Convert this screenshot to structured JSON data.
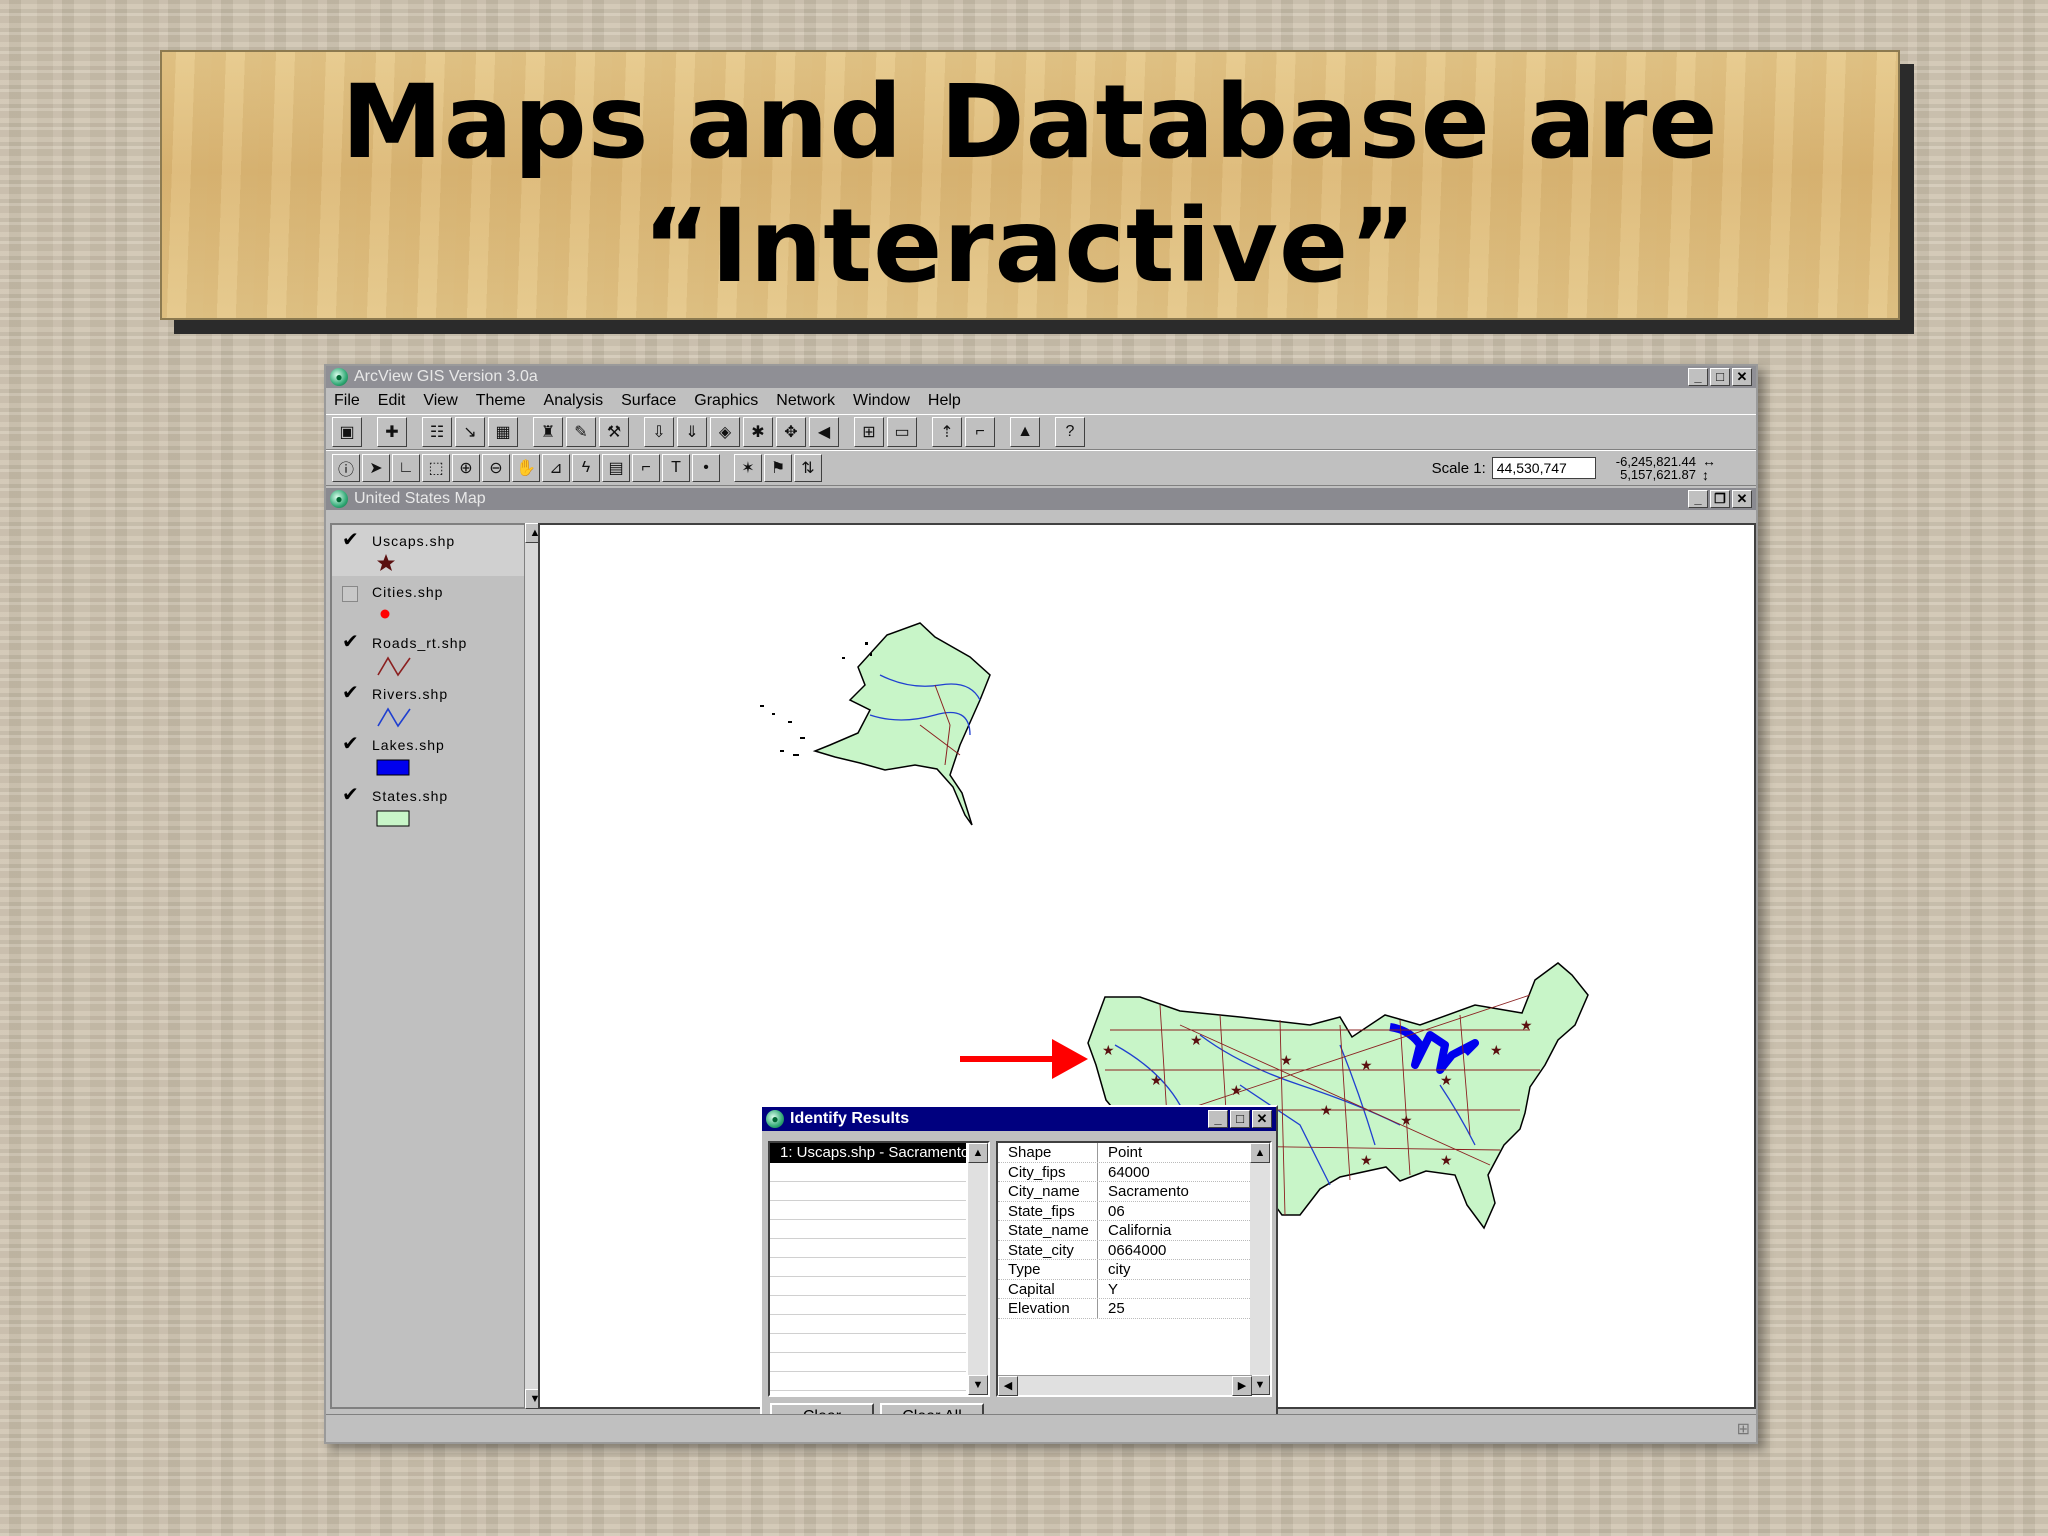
{
  "slide": {
    "title_line1": "Maps and Database are",
    "title_line2": "“Interactive”"
  },
  "app": {
    "title": "ArcView GIS Version 3.0a",
    "menu": [
      "File",
      "Edit",
      "View",
      "Theme",
      "Analysis",
      "Surface",
      "Graphics",
      "Network",
      "Window",
      "Help"
    ],
    "scale_label": "Scale 1:",
    "scale_value": "44,530,747",
    "coord_x": "-6,245,821.44",
    "coord_y": "5,157,621.87"
  },
  "map_window": {
    "title": "United States Map"
  },
  "legend": {
    "items": [
      {
        "name": "Uscaps.shp",
        "checked": true,
        "symbol": "star-icon",
        "color": "#5a1010"
      },
      {
        "name": "Cities.shp",
        "checked": false,
        "symbol": "dot",
        "color": "#ff0000"
      },
      {
        "name": "Roads_rt.shp",
        "checked": true,
        "symbol": "line",
        "color": "#8b2020"
      },
      {
        "name": "Rivers.shp",
        "checked": true,
        "symbol": "line",
        "color": "#1f3fd0"
      },
      {
        "name": "Lakes.shp",
        "checked": true,
        "symbol": "fill",
        "color": "#0000ee"
      },
      {
        "name": "States.shp",
        "checked": true,
        "symbol": "fill",
        "color": "#c8f5c8"
      }
    ]
  },
  "identify": {
    "title": "Identify Results",
    "selected_row": "1:  Uscaps.shp - Sacramento",
    "attributes": [
      {
        "k": "Shape",
        "v": "Point"
      },
      {
        "k": "City_fips",
        "v": "64000"
      },
      {
        "k": "City_name",
        "v": "Sacramento"
      },
      {
        "k": "State_fips",
        "v": "06"
      },
      {
        "k": "State_name",
        "v": "California"
      },
      {
        "k": "State_city",
        "v": "0664000"
      },
      {
        "k": "Type",
        "v": "city"
      },
      {
        "k": "Capital",
        "v": "Y"
      },
      {
        "k": "Elevation",
        "v": "25"
      }
    ],
    "clear_label": "Clear",
    "clear_all_label": "Clear All"
  },
  "colors": {
    "land": "#c8f5c8",
    "roads": "#8b2020",
    "rivers": "#2040d0",
    "lakes": "#0000ee",
    "arrow": "#ff0000",
    "id_titlebar": "#00007f"
  }
}
